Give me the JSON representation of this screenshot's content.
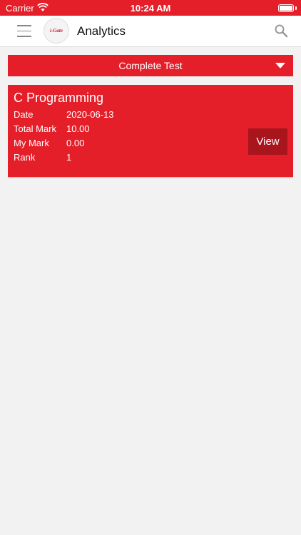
{
  "status_bar": {
    "carrier": "Carrier",
    "time": "10:24 AM"
  },
  "nav": {
    "title": "Analytics",
    "logo_text": "i-Gate",
    "icons": [
      "menu-icon",
      "search-icon"
    ]
  },
  "filter": {
    "selected": "Complete Test"
  },
  "results": [
    {
      "title": "C Programming",
      "rows": [
        {
          "label": "Date",
          "value": "2020-06-13"
        },
        {
          "label": "Total Mark",
          "value": "10.00"
        },
        {
          "label": "My Mark",
          "value": "0.00"
        },
        {
          "label": "Rank",
          "value": "1"
        }
      ],
      "action_label": "View"
    }
  ],
  "colors": {
    "primary": "#e41f2a",
    "button_dark": "#a8151d",
    "background": "#f2f2f2"
  }
}
